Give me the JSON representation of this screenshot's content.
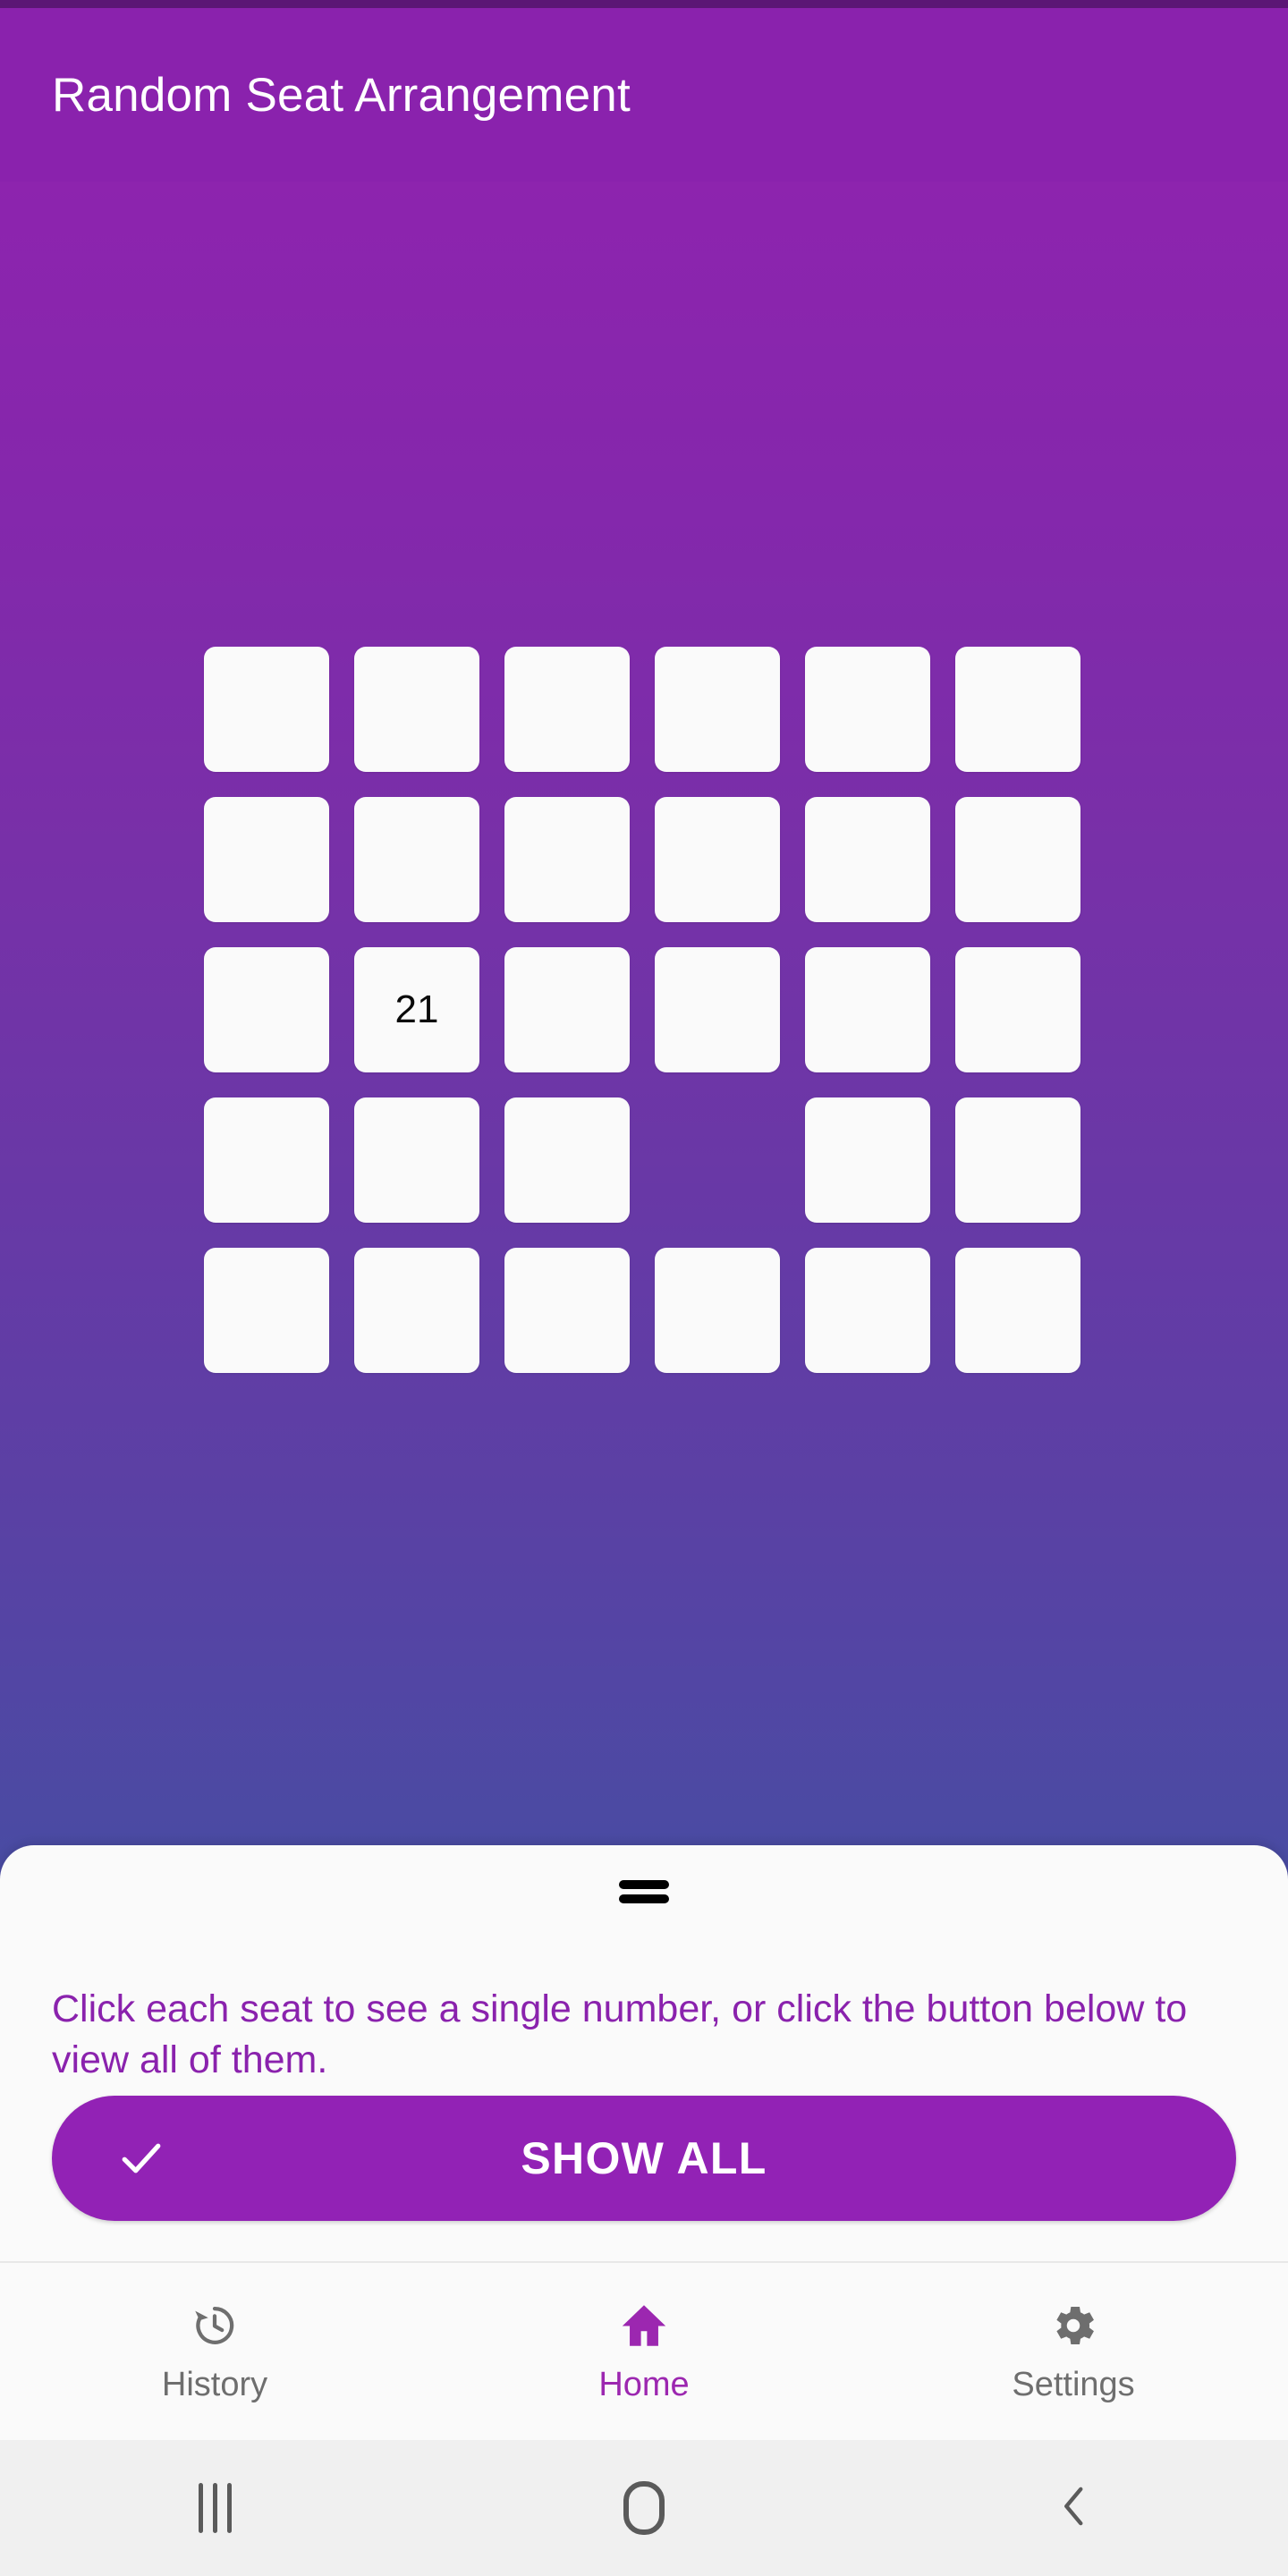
{
  "app": {
    "title": "Random Seat Arrangement",
    "accent_color": "#8A22AD",
    "appbar_color": "#8A22AD",
    "background_gradient_top": "#8D24AE",
    "background_gradient_bottom": "#4A4BA3"
  },
  "seat_grid": {
    "rows": 5,
    "columns": 6,
    "seat_color": "#FAFAFA",
    "seats": [
      [
        {
          "label": "",
          "state": "seat"
        },
        {
          "label": "",
          "state": "seat"
        },
        {
          "label": "",
          "state": "seat"
        },
        {
          "label": "",
          "state": "seat"
        },
        {
          "label": "",
          "state": "seat"
        },
        {
          "label": "",
          "state": "seat"
        }
      ],
      [
        {
          "label": "",
          "state": "seat"
        },
        {
          "label": "",
          "state": "seat"
        },
        {
          "label": "",
          "state": "seat"
        },
        {
          "label": "",
          "state": "seat"
        },
        {
          "label": "",
          "state": "seat"
        },
        {
          "label": "",
          "state": "seat"
        }
      ],
      [
        {
          "label": "",
          "state": "seat"
        },
        {
          "label": "21",
          "state": "seat"
        },
        {
          "label": "",
          "state": "seat"
        },
        {
          "label": "",
          "state": "seat"
        },
        {
          "label": "",
          "state": "seat"
        },
        {
          "label": "",
          "state": "seat"
        }
      ],
      [
        {
          "label": "",
          "state": "seat"
        },
        {
          "label": "",
          "state": "seat"
        },
        {
          "label": "",
          "state": "seat"
        },
        {
          "label": "",
          "state": "empty"
        },
        {
          "label": "",
          "state": "seat"
        },
        {
          "label": "",
          "state": "seat"
        }
      ],
      [
        {
          "label": "",
          "state": "seat"
        },
        {
          "label": "",
          "state": "seat"
        },
        {
          "label": "",
          "state": "seat"
        },
        {
          "label": "",
          "state": "seat"
        },
        {
          "label": "",
          "state": "seat"
        },
        {
          "label": "",
          "state": "seat"
        }
      ]
    ]
  },
  "bottom_sheet": {
    "handle_icon": "drag-handle-icon",
    "instruction": "Click each seat to see a single number, or click the button below to view all of them.",
    "instruction_color": "#8A22AD",
    "show_all": {
      "label": "SHOW ALL",
      "icon": "check-icon",
      "color": "#9222B5"
    }
  },
  "bottom_nav": {
    "items": [
      {
        "label": "History",
        "icon": "history-clock-icon",
        "active": false
      },
      {
        "label": "Home",
        "icon": "home-icon",
        "active": true
      },
      {
        "label": "Settings",
        "icon": "gear-icon",
        "active": false
      }
    ],
    "active_color": "#9C27B0",
    "inactive_color": "#6E6E6E"
  },
  "system_nav": {
    "recents_icon": "recents-icon",
    "home_icon": "system-home-icon",
    "back_icon": "back-chevron-icon"
  }
}
